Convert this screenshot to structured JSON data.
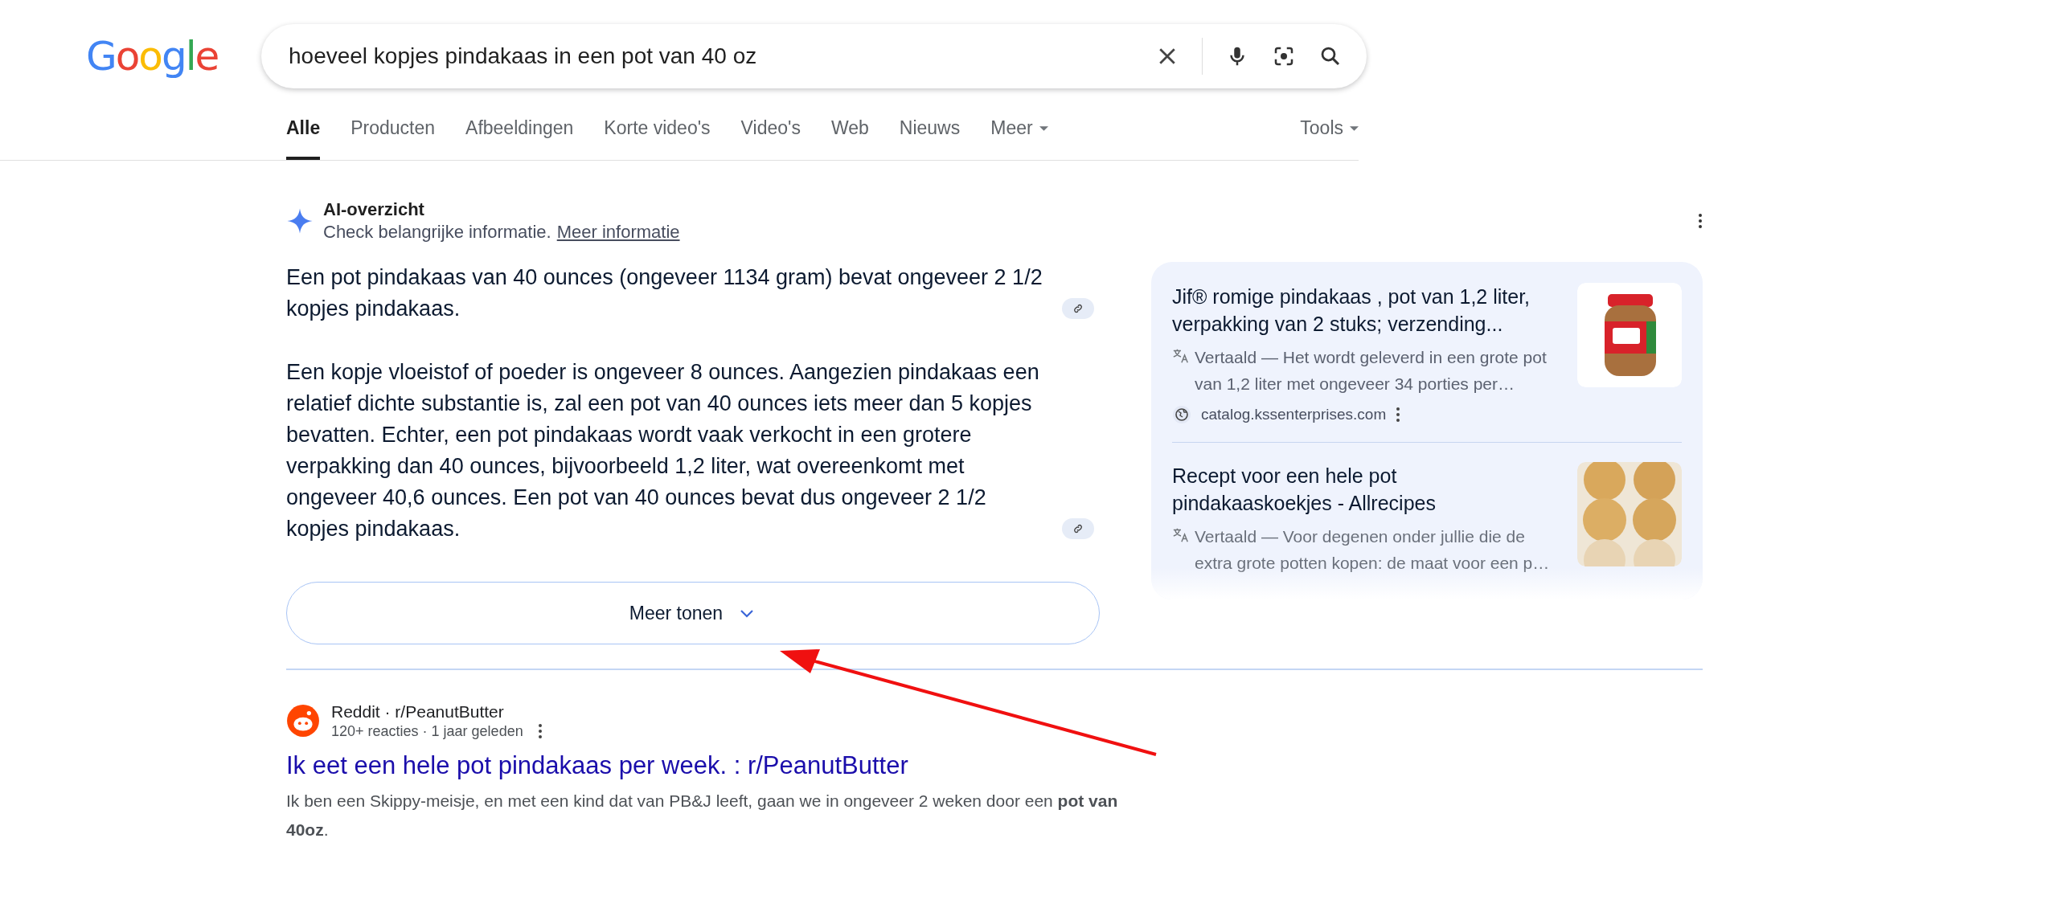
{
  "logo": "Google",
  "search": {
    "value": "hoeveel kopjes pindakaas in een pot van 40 oz"
  },
  "tabs": [
    {
      "label": "Alle",
      "selected": true,
      "dropdown": false
    },
    {
      "label": "Producten",
      "selected": false,
      "dropdown": false
    },
    {
      "label": "Afbeeldingen",
      "selected": false,
      "dropdown": false
    },
    {
      "label": "Korte video's",
      "selected": false,
      "dropdown": false
    },
    {
      "label": "Video's",
      "selected": false,
      "dropdown": false
    },
    {
      "label": "Web",
      "selected": false,
      "dropdown": false
    },
    {
      "label": "Nieuws",
      "selected": false,
      "dropdown": false
    },
    {
      "label": "Meer",
      "selected": false,
      "dropdown": true
    }
  ],
  "tools": {
    "label": "Tools"
  },
  "ai_overview": {
    "title": "AI-overzicht",
    "subtitle": "Check belangrijke informatie.",
    "link": "Meer informatie",
    "paragraphs": [
      "Een pot pindakaas van 40 ounces (ongeveer 1134 gram) bevat ongeveer 2 1/2 kopjes pindakaas.",
      "Een kopje vloeistof of poeder is ongeveer 8 ounces. Aangezien pindakaas een relatief dichte substantie is, zal een pot van 40 ounces iets meer dan 5 kopjes bevatten. Echter, een pot pindakaas wordt vaak verkocht in een grotere verpakking dan 40 ounces, bijvoorbeeld 1,2 liter, wat overeenkomt met ongeveer 40,6 ounces. Een pot van 40 ounces bevat dus ongeveer 2 1/2 kopjes pindakaas."
    ],
    "more_button": "Meer tonen",
    "sources": [
      {
        "title": "Jif® romige pindakaas , pot van 1,2 liter, verpakking van 2 stuks; verzending...",
        "snippet": "Vertaald — Het wordt geleverd in een grote pot van 1,2 liter met ongeveer 34 porties per…",
        "site": "catalog.kssenterprises.com",
        "kind": "product",
        "faded": false
      },
      {
        "title": "Recept voor een hele pot pindakaaskoekjes - Allrecipes",
        "snippet": "Vertaald — Voor degenen onder jullie die de extra grote potten kopen: de maat voor een p…",
        "kind": "recipe",
        "faded": true
      }
    ]
  },
  "results": [
    {
      "source": "Reddit · r/PeanutButter",
      "meta": "120+ reacties · 1 jaar geleden",
      "title": "Ik eet een hele pot pindakaas per week. : r/PeanutButter",
      "snippet": "Ik ben een Skippy-meisje, en met een kind dat van PB&J leeft, gaan we in ongeveer 2 weken door een **pot van 40oz**."
    }
  ]
}
